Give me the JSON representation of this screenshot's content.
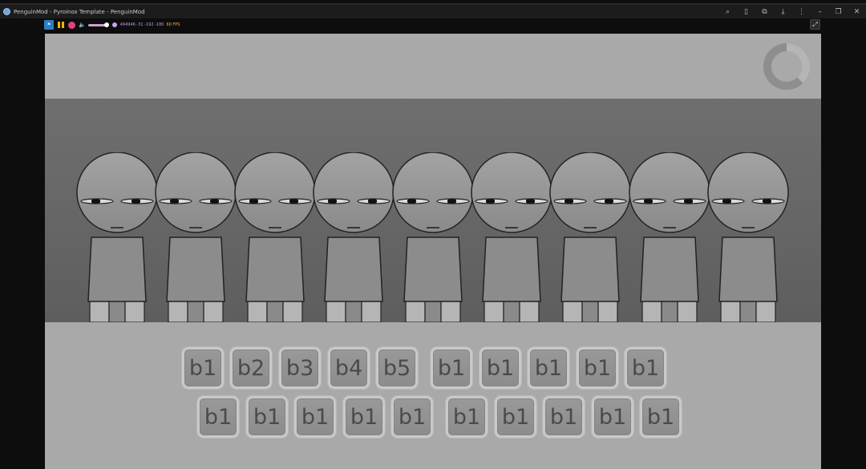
{
  "window": {
    "title": "PenguinMod - Pyroinox Template - PenguinMod",
    "controls": [
      "search-icon",
      "document-icon",
      "extensions-icon",
      "download-icon",
      "more-icon",
      "minimize-icon",
      "restore-icon",
      "close-icon"
    ]
  },
  "toolbar": {
    "flag_label": "flag",
    "coords": "494946 -31 -192 -180",
    "fps": "60 FPS",
    "volume_level": 0.9
  },
  "stage": {
    "characters": [
      1,
      2,
      3,
      4,
      5,
      6,
      7,
      8,
      9
    ],
    "row1": [
      "b1",
      "b2",
      "b3",
      "b4",
      "b5",
      "b1",
      "b1",
      "b1",
      "b1",
      "b1"
    ],
    "row2": [
      "b1",
      "b1",
      "b1",
      "b1",
      "b1",
      "b1",
      "b1",
      "b1",
      "b1",
      "b1"
    ]
  },
  "colors": {
    "stage_panel": "#a9a9a9",
    "stage_floor": "#666666",
    "character_fill": "#8c8c8c"
  }
}
